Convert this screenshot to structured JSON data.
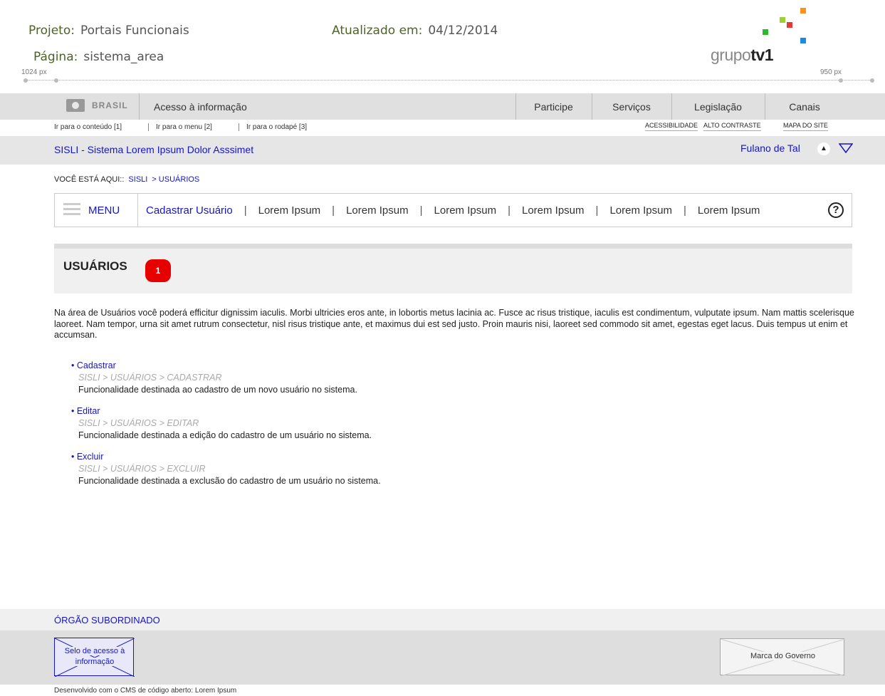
{
  "annotations": {
    "project_label": "Projeto:",
    "project_value": "Portais Funcionais",
    "page_label": "Página:",
    "page_value": "sistema_area",
    "updated_label": "Atualizado em:",
    "updated_value": "04/12/2014",
    "ruler_left": "1024 px",
    "ruler_right": "950 px"
  },
  "logo": {
    "prefix": "grupo",
    "bold": "tv1"
  },
  "govbar": {
    "brand": "BRASIL",
    "acesso": "Acesso à informação",
    "items": [
      "Participe",
      "Serviços",
      "Legislação",
      "Canais"
    ]
  },
  "links": {
    "skip": [
      "Ir para o conteúdo [1]",
      "Ir para o menu [2]",
      "Ir para o rodapé [3]"
    ],
    "util": [
      "ACESSIBILIDADE",
      "ALTO CONTRASTE",
      "MAPA DO SITE"
    ]
  },
  "system": {
    "title": "SISLI - Sistema Lorem Ipsum Dolor Asssimet",
    "user": "Fulano de Tal"
  },
  "breadcrumb": {
    "label": "VOCÊ ESTÁ AQUI::",
    "items": [
      "SISLI",
      "> USUÁRIOS"
    ]
  },
  "menu": {
    "label": "MENU",
    "items": [
      "Cadastrar Usuário",
      "Lorem Ipsum",
      "Lorem Ipsum",
      "Lorem Ipsum",
      "Lorem Ipsum",
      "Lorem Ipsum",
      "Lorem Ipsum"
    ],
    "help": "?"
  },
  "section": {
    "title": "USUÁRIOS",
    "badge": "1"
  },
  "intro": "Na área de Usuários você poderá  efficitur dignissim iaculis. Morbi ultricies eros ante, in lobortis metus lacinia ac. Fusce ac risus tristique, iaculis est condimentum, vulputate ipsum. Nam mattis scelerisque laoreet. Nam tempor, urna sit amet rutrum consectetur, nisl risus tristique ante, et maximus dui est sed justo. Proin mauris nisi, laoreet sed commodo sit amet, egestas eget lacus. Duis tempus ut enim et accumsan.",
  "features": [
    {
      "title": "• Cadastrar",
      "path": "SISLI > USUÁRIOS > CADASTRAR",
      "desc": "Funcionalidade destinada ao cadastro de um novo usuário no sistema."
    },
    {
      "title": "• Editar",
      "path": "SISLI > USUÁRIOS > EDITAR",
      "desc": "Funcionalidade destinada a edição do cadastro de um usuário no sistema."
    },
    {
      "title": "• Excluir",
      "path": "SISLI > USUÁRIOS > EXCLUIR",
      "desc": "Funcionalidade destinada a exclusão do cadastro de um usuário no sistema."
    }
  ],
  "footer": {
    "org": "ÓRGÃO SUBORDINADO",
    "seal_line1": "Selo de acesso à",
    "seal_line2": "informação",
    "marca": "Marca do Governo",
    "dev": "Desenvolvido com o CMS de código aberto: Lorem Ipsum"
  },
  "colors": {
    "link": "#1515c8",
    "annotation": "#4f6228",
    "badge": "#e60000"
  }
}
